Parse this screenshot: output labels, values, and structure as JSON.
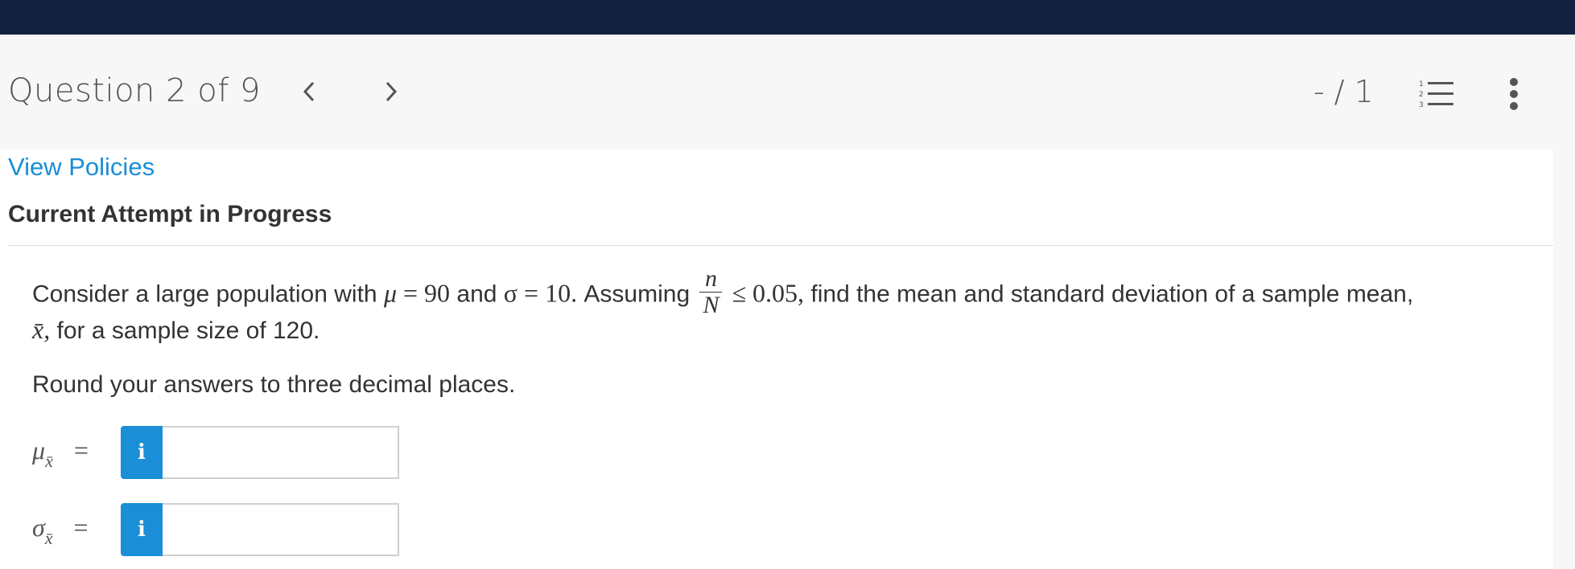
{
  "header": {
    "question_title": "Question 2 of 9",
    "score": "- / 1",
    "prev_icon": "chevron-left-icon",
    "next_icon": "chevron-right-icon",
    "list_icon": "numbered-list-icon",
    "more_icon": "more-vertical-icon"
  },
  "links": {
    "view_policies": "View Policies"
  },
  "attempt_heading": "Current Attempt in Progress",
  "question": {
    "text_1": "Consider a large population with ",
    "mu": "μ",
    "eq_1": " = 90",
    "text_and": " and ",
    "sigma": "σ",
    "eq_2": " = 10.",
    "text_assuming": " Assuming ",
    "frac_num": "n",
    "frac_den": "N",
    "eq_3": " ≤ 0.05,",
    "text_2": " find the mean and standard deviation of a sample mean,",
    "xbar": "x̄,",
    "text_3": " for a sample size of 120."
  },
  "instruction": "Round your answers to three decimal places.",
  "answers": [
    {
      "symbol": "μ",
      "subscript": "x̄",
      "equals": "=",
      "info_label": "i",
      "value": ""
    },
    {
      "symbol": "σ",
      "subscript": "x̄",
      "equals": "=",
      "info_label": "i",
      "value": ""
    }
  ],
  "colors": {
    "topbar": "#13203f",
    "link": "#1a8ed6",
    "info_button": "#1a8ed6"
  }
}
